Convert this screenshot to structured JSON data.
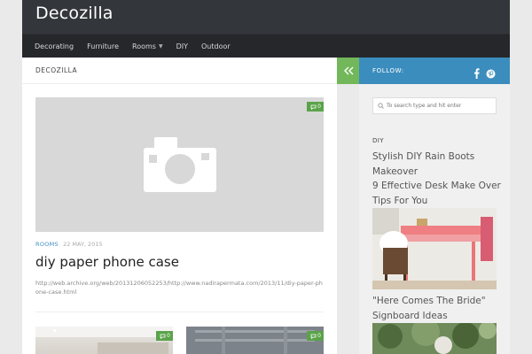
{
  "site": {
    "title": "Decozilla"
  },
  "nav": [
    {
      "label": "Decorating"
    },
    {
      "label": "Furniture"
    },
    {
      "label": "Rooms",
      "dropdown": true
    },
    {
      "label": "DIY"
    },
    {
      "label": "Outdoor"
    }
  ],
  "breadcrumb": "DECOZILLA",
  "post": {
    "comments": "0",
    "category": "ROOMS",
    "date": "22 MAY, 2015",
    "title": "diy paper phone case",
    "excerpt": "http://web.archive.org/web/20131206052253/http://www.nadirapermata.com/2013/11/diy-paper-phone-case.html"
  },
  "thumbs": [
    {
      "comments": "0"
    },
    {
      "comments": "0"
    }
  ],
  "sidebar": {
    "follow_label": "FOLLOW:",
    "social_icons": [
      "facebook-icon",
      "pinterest-icon"
    ],
    "search_placeholder": "To search type and hit enter",
    "widget_title": "DIY",
    "posts": [
      {
        "title": "Stylish DIY Rain Boots Makeover"
      },
      {
        "title": "9 Effective Desk Make Over Tips For You"
      },
      {
        "title": "\"Here Comes The Bride\" Signboard Ideas"
      }
    ]
  },
  "colors": {
    "header": "#33363b",
    "nav": "#26272b",
    "accent_blue": "#3b8dbd",
    "accent_green": "#72b85a",
    "comment_badge": "#5aa34a"
  }
}
